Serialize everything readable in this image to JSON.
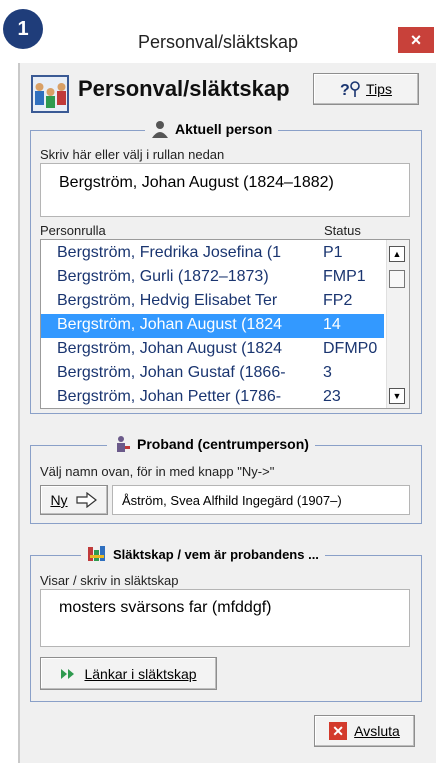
{
  "step_number": "1",
  "window": {
    "title": "Personval/släktskap",
    "close_glyph": "×"
  },
  "header": {
    "title": "Personval/släktskap",
    "tips_label": "Tips",
    "tips_icon": "question-key-icon"
  },
  "aktuell": {
    "legend": "Aktuell person",
    "input_label": "Skriv här eller välj i rullan nedan",
    "input_value": "Bergström, Johan August (1824–1882)",
    "list_header_name": "Personrulla",
    "list_header_status": "Status",
    "rows": [
      {
        "name": "Bergström, Fredrika Josefina (1",
        "status": "P1",
        "selected": false
      },
      {
        "name": "Bergström, Gurli (1872–1873)",
        "status": "FMP1",
        "selected": false
      },
      {
        "name": "Bergström, Hedvig Elisabet Ter",
        "status": "FP2",
        "selected": false
      },
      {
        "name": "Bergström, Johan August (1824",
        "status": "14",
        "selected": true
      },
      {
        "name": "Bergström, Johan August (1824",
        "status": "DFMP0",
        "selected": false
      },
      {
        "name": "Bergström, Johan Gustaf (1866-",
        "status": "3",
        "selected": false
      },
      {
        "name": "Bergström, Johan Petter (1786-",
        "status": "23",
        "selected": false
      }
    ]
  },
  "proband": {
    "legend": "Proband (centrumperson)",
    "hint": "Välj namn ovan, för in med knapp \"Ny->\"",
    "ny_label": "Ny",
    "value": "Åström, Svea Alfhild Ingegärd (1907–)"
  },
  "slaktskap": {
    "legend": "Släktskap / vem är probandens ...",
    "label": "Visar / skriv in släktskap",
    "value": "mosters svärsons far (mfddgf)",
    "link_button": "Länkar i släktskap"
  },
  "footer": {
    "close_label": "Avsluta"
  },
  "colors": {
    "badge": "#1f3d7a",
    "close": "#c8413a",
    "selection": "#3399ff",
    "list_text": "#1a3570"
  }
}
